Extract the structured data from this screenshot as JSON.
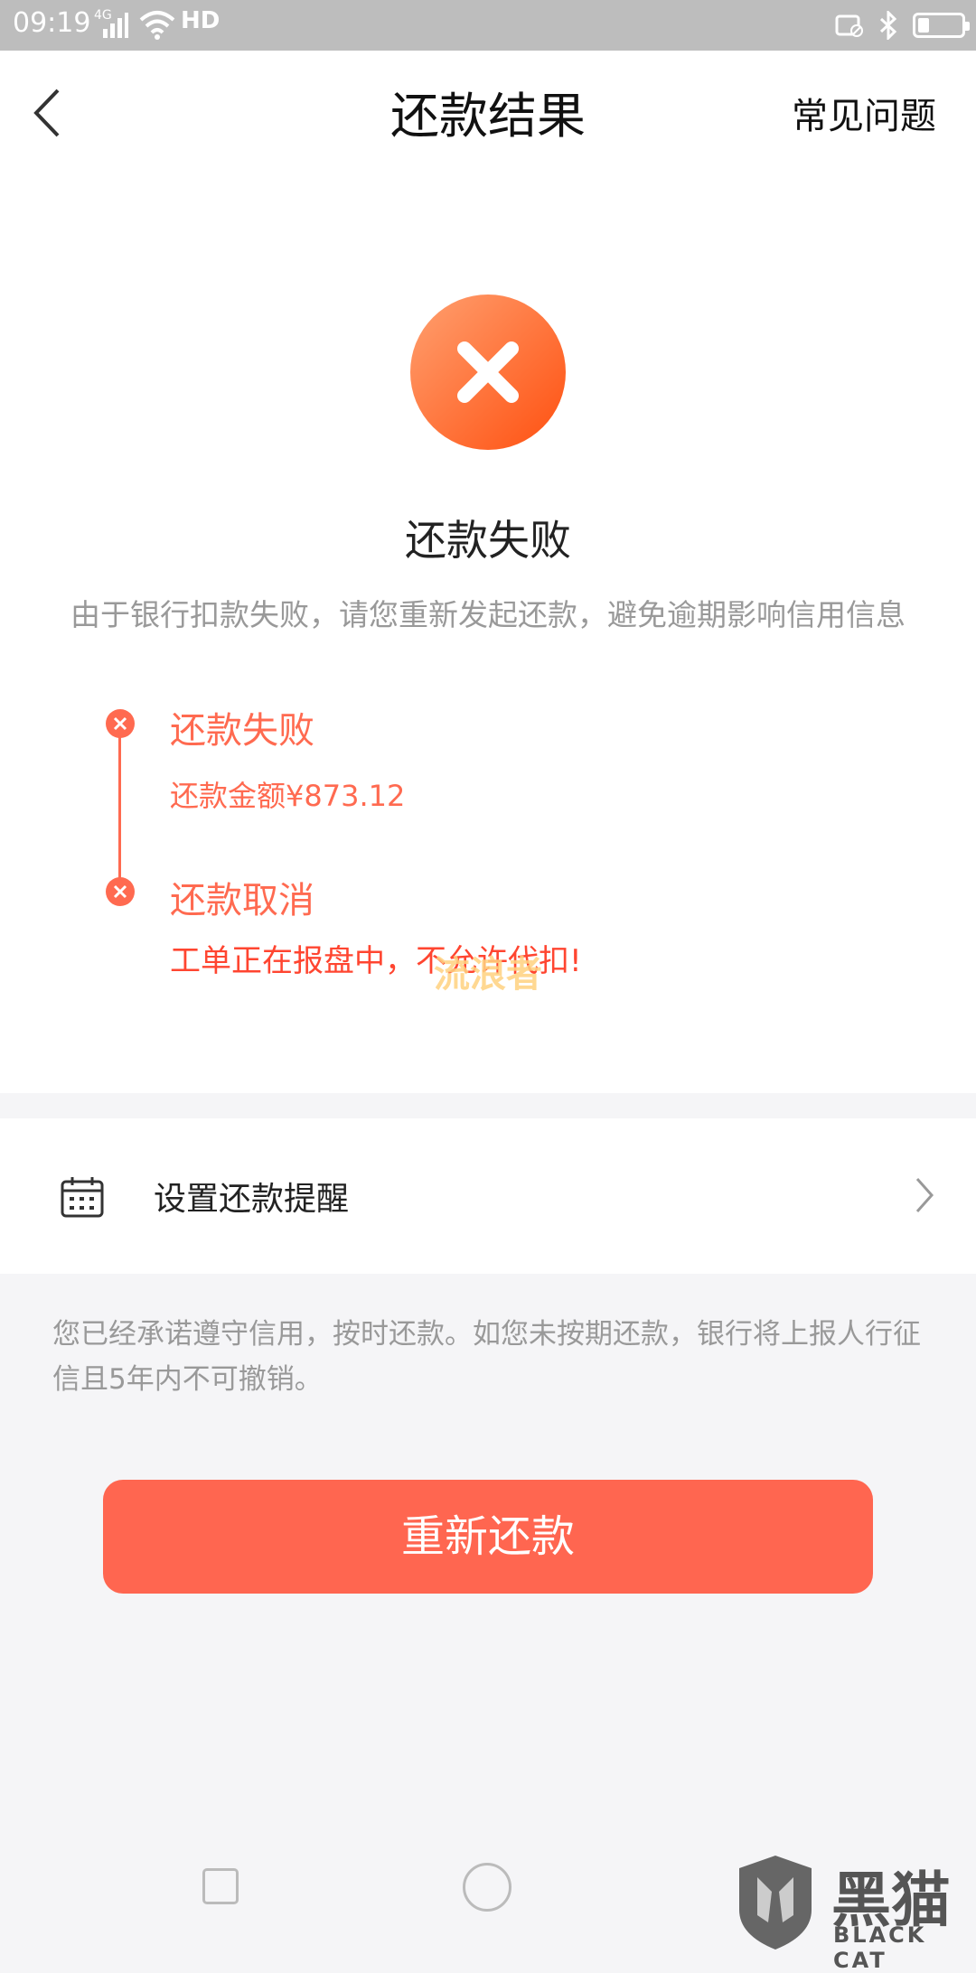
{
  "status_bar": {
    "time": "09:19",
    "network": "4G",
    "hd": "HD"
  },
  "header": {
    "title": "还款结果",
    "faq_label": "常见问题"
  },
  "result": {
    "title": "还款失败",
    "description": "由于银行扣款失败，请您重新发起还款，避免逾期影响信用信息"
  },
  "timeline": [
    {
      "title": "还款失败",
      "detail": "还款金额¥873.12"
    },
    {
      "title": "还款取消",
      "detail": "工单正在报盘中，不允许代扣!"
    }
  ],
  "watermark_text": "流浪者",
  "reminder": {
    "label": "设置还款提醒"
  },
  "notice": "您已经承诺遵守信用，按时还款。如您未按期还款，银行将上报人行征信且5年内不可撤销。",
  "retry_button": "重新还款",
  "logo": {
    "cn": "黑猫",
    "en": "BLACK CAT"
  },
  "colors": {
    "accent": "#ff6650",
    "timeline": "#ff6a50",
    "status_bar": "#bdbdbd"
  }
}
